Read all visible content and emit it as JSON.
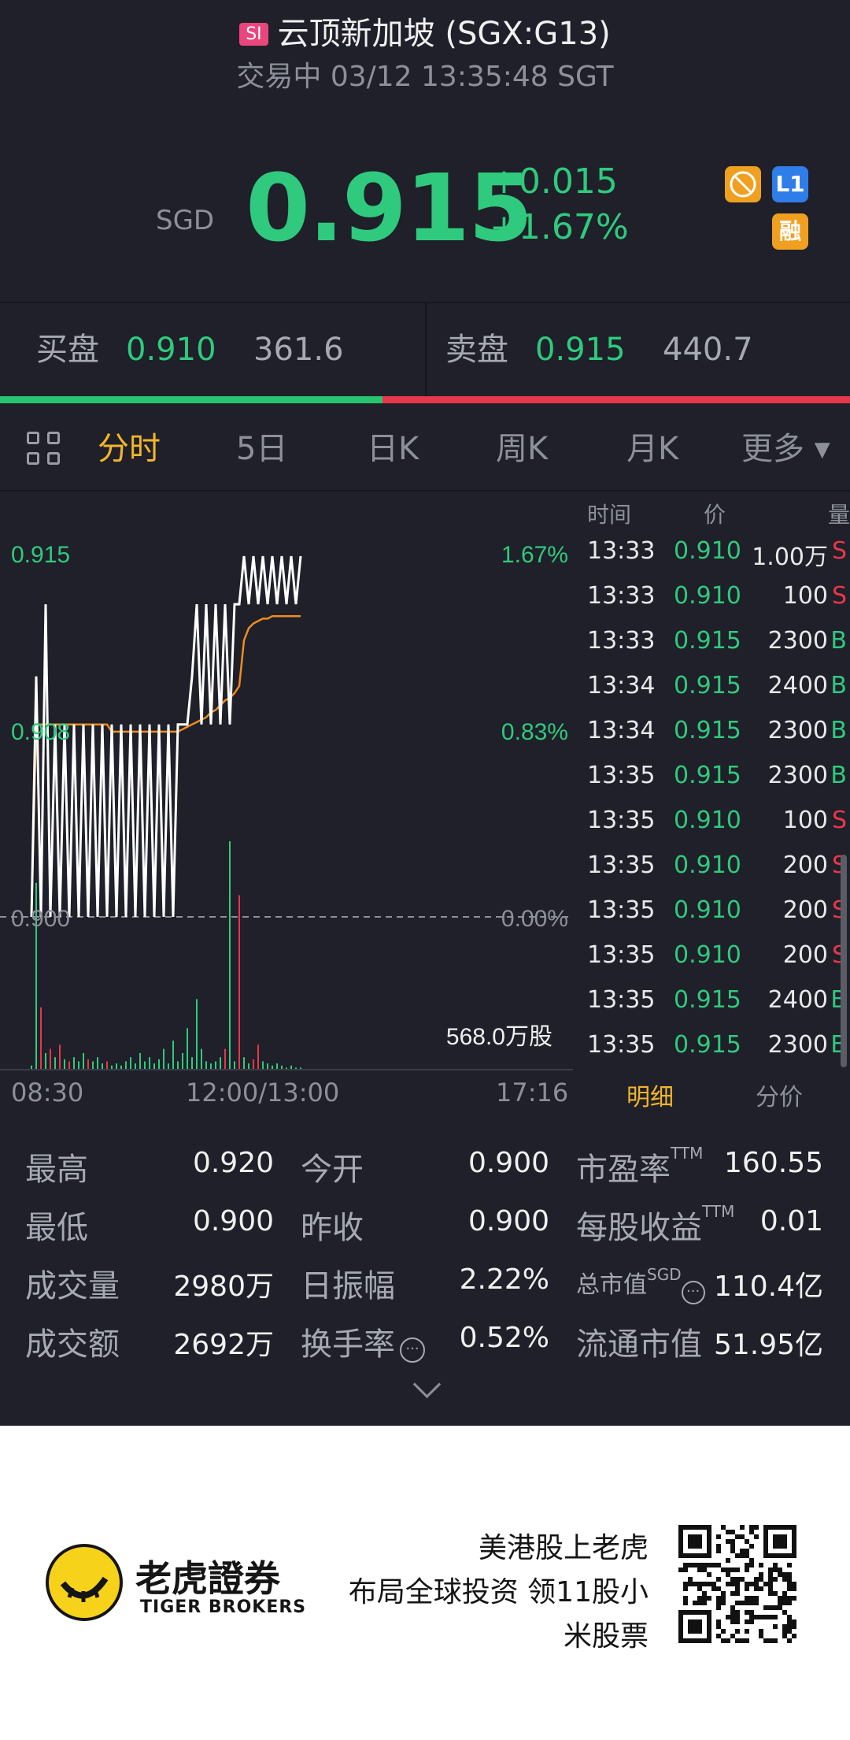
{
  "header": {
    "badge": "SI",
    "title": "云顶新加坡 (SGX:G13)",
    "status": "交易中 03/12 13:35:48 SGT"
  },
  "quote": {
    "currency": "SGD",
    "price": "0.915",
    "change": "+0.015",
    "change_pct": "+1.67%",
    "badges": {
      "l1": "L1",
      "margin": "融"
    }
  },
  "bid_ask": {
    "bid_label": "买盘",
    "bid_price": "0.910",
    "bid_qty": "361.6",
    "ask_label": "卖盘",
    "ask_price": "0.915",
    "ask_qty": "440.7",
    "bid_fraction": 0.45
  },
  "tabs": [
    "分时",
    "5日",
    "日K",
    "周K",
    "月K",
    "更多"
  ],
  "active_tab": "分时",
  "chart_data": {
    "type": "line",
    "y_labels": [
      "0.915",
      "0.908",
      "0.900"
    ],
    "pct_labels": [
      "1.67%",
      "0.83%",
      "0.00%"
    ],
    "x_labels": [
      "08:30",
      "12:00/13:00",
      "17:16"
    ],
    "volume_label": "568.0万股",
    "ylim": [
      0.9,
      0.915
    ],
    "series": [
      {
        "values": [
          0.9,
          0.91,
          0.9,
          0.913,
          0.9,
          0.908,
          0.9,
          0.908,
          0.9,
          0.908,
          0.9,
          0.908,
          0.9,
          0.908,
          0.9,
          0.908,
          0.9,
          0.908,
          0.9,
          0.908,
          0.9,
          0.908,
          0.9,
          0.908,
          0.9,
          0.908,
          0.9,
          0.908,
          0.9,
          0.908,
          0.9,
          0.908,
          0.908,
          0.908,
          0.91,
          0.913,
          0.908,
          0.913,
          0.908,
          0.913,
          0.908,
          0.913,
          0.908,
          0.913,
          0.913,
          0.915,
          0.913,
          0.915,
          0.913,
          0.915,
          0.913,
          0.915,
          0.913,
          0.915,
          0.913,
          0.915,
          0.913,
          0.915
        ]
      },
      {
        "values": [
          0.9,
          0.908,
          0.908,
          0.908,
          0.908,
          0.908,
          0.908,
          0.908,
          0.908,
          0.908,
          0.908,
          0.908,
          0.908,
          0.908,
          0.908,
          0.908,
          0.908,
          0.9077,
          0.9077,
          0.9077,
          0.9077,
          0.9077,
          0.9077,
          0.9077,
          0.9077,
          0.9077,
          0.9077,
          0.9077,
          0.9077,
          0.9077,
          0.9077,
          0.9077,
          0.9078,
          0.9079,
          0.908,
          0.9081,
          0.9082,
          0.9083,
          0.9085,
          0.9086,
          0.9088,
          0.909,
          0.9091,
          0.9093,
          0.9096,
          0.9115,
          0.912,
          0.9122,
          0.9123,
          0.9124,
          0.9124,
          0.9125,
          0.9125,
          0.9125,
          0.9125,
          0.9125,
          0.9125,
          0.9125
        ]
      }
    ],
    "volumes": [
      {
        "v": 2,
        "c": "g"
      },
      {
        "v": 90,
        "c": "g"
      },
      {
        "v": 30,
        "c": "r"
      },
      {
        "v": 8,
        "c": "g"
      },
      {
        "v": 10,
        "c": "r"
      },
      {
        "v": 6,
        "c": "g"
      },
      {
        "v": 12,
        "c": "r"
      },
      {
        "v": 5,
        "c": "g"
      },
      {
        "v": 4,
        "c": "r"
      },
      {
        "v": 6,
        "c": "g"
      },
      {
        "v": 4,
        "c": "g"
      },
      {
        "v": 8,
        "c": "g"
      },
      {
        "v": 5,
        "c": "r"
      },
      {
        "v": 4,
        "c": "g"
      },
      {
        "v": 6,
        "c": "g"
      },
      {
        "v": 3,
        "c": "g"
      },
      {
        "v": 4,
        "c": "r"
      },
      {
        "v": 2,
        "c": "g"
      },
      {
        "v": 3,
        "c": "g"
      },
      {
        "v": 2,
        "c": "g"
      },
      {
        "v": 4,
        "c": "g"
      },
      {
        "v": 6,
        "c": "g"
      },
      {
        "v": 3,
        "c": "g"
      },
      {
        "v": 8,
        "c": "g"
      },
      {
        "v": 4,
        "c": "g"
      },
      {
        "v": 6,
        "c": "g"
      },
      {
        "v": 3,
        "c": "g"
      },
      {
        "v": 5,
        "c": "g"
      },
      {
        "v": 10,
        "c": "g"
      },
      {
        "v": 3,
        "c": "g"
      },
      {
        "v": 14,
        "c": "g"
      },
      {
        "v": 4,
        "c": "g"
      },
      {
        "v": 8,
        "c": "g"
      },
      {
        "v": 20,
        "c": "g"
      },
      {
        "v": 6,
        "c": "g"
      },
      {
        "v": 34,
        "c": "g"
      },
      {
        "v": 10,
        "c": "g"
      },
      {
        "v": 4,
        "c": "g"
      },
      {
        "v": 3,
        "c": "g"
      },
      {
        "v": 4,
        "c": "g"
      },
      {
        "v": 6,
        "c": "g"
      },
      {
        "v": 10,
        "c": "r"
      },
      {
        "v": 110,
        "c": "g"
      },
      {
        "v": 4,
        "c": "g"
      },
      {
        "v": 84,
        "c": "r"
      },
      {
        "v": 6,
        "c": "g"
      },
      {
        "v": 3,
        "c": "g"
      },
      {
        "v": 5,
        "c": "r"
      },
      {
        "v": 12,
        "c": "r"
      },
      {
        "v": 4,
        "c": "g"
      },
      {
        "v": 3,
        "c": "g"
      },
      {
        "v": 2,
        "c": "g"
      },
      {
        "v": 3,
        "c": "g"
      },
      {
        "v": 2,
        "c": "g"
      },
      {
        "v": 1,
        "c": "g"
      },
      {
        "v": 2,
        "c": "g"
      },
      {
        "v": 1,
        "c": "g"
      },
      {
        "v": 1,
        "c": "g"
      }
    ],
    "colors": {
      "price": "#ffffff",
      "avg": "#f08c1e",
      "up": "#2fca7d",
      "down": "#e8364a"
    }
  },
  "trades": {
    "headers": [
      "时间",
      "价",
      "量"
    ],
    "rows": [
      {
        "time": "13:33",
        "price": "0.910",
        "vol": "1.00万",
        "side": "S"
      },
      {
        "time": "13:33",
        "price": "0.910",
        "vol": "100",
        "side": "S"
      },
      {
        "time": "13:33",
        "price": "0.915",
        "vol": "2300",
        "side": "B"
      },
      {
        "time": "13:34",
        "price": "0.915",
        "vol": "2400",
        "side": "B"
      },
      {
        "time": "13:34",
        "price": "0.915",
        "vol": "2300",
        "side": "B"
      },
      {
        "time": "13:35",
        "price": "0.915",
        "vol": "2300",
        "side": "B"
      },
      {
        "time": "13:35",
        "price": "0.910",
        "vol": "100",
        "side": "S"
      },
      {
        "time": "13:35",
        "price": "0.910",
        "vol": "200",
        "side": "S"
      },
      {
        "time": "13:35",
        "price": "0.910",
        "vol": "200",
        "side": "S"
      },
      {
        "time": "13:35",
        "price": "0.910",
        "vol": "200",
        "side": "S"
      },
      {
        "time": "13:35",
        "price": "0.915",
        "vol": "2400",
        "side": "B"
      },
      {
        "time": "13:35",
        "price": "0.915",
        "vol": "2300",
        "side": "B"
      }
    ],
    "tab_detail": "明细",
    "tab_price": "分价"
  },
  "stats": {
    "high_label": "最高",
    "high": "0.920",
    "open_label": "今开",
    "open": "0.900",
    "pe_label": "市盈率",
    "pe_sup": "TTM",
    "pe": "160.55",
    "low_label": "最低",
    "low": "0.900",
    "prev_label": "昨收",
    "prev": "0.900",
    "eps_label": "每股收益",
    "eps_sup": "TTM",
    "eps": "0.01",
    "vol_label": "成交量",
    "vol": "2980万",
    "amp_label": "日振幅",
    "amp": "2.22%",
    "mcap_label": "总市值",
    "mcap_sup": "SGD",
    "mcap": "110.4亿",
    "amt_label": "成交额",
    "amt": "2692万",
    "turn_label": "换手率",
    "turn": "0.52%",
    "float_label": "流通市值",
    "float": "51.95亿"
  },
  "footer": {
    "brand_cn": "老虎證券",
    "brand_en": "TIGER BROKERS",
    "slogan_1": "美港股上老虎",
    "slogan_2": "布局全球投资 领11股小",
    "slogan_3": "米股票"
  }
}
